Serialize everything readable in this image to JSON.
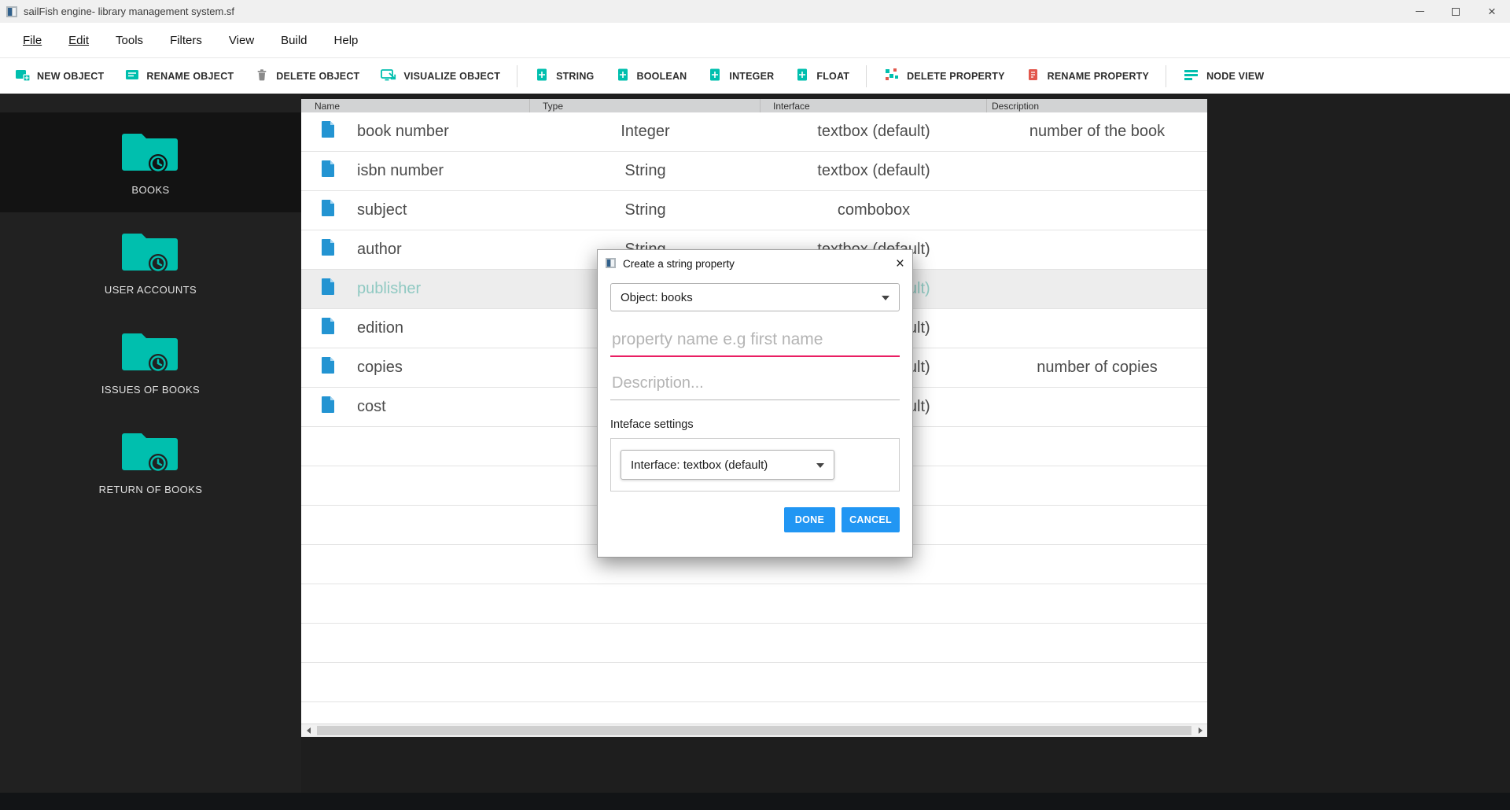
{
  "window": {
    "title": "sailFish engine- library management system.sf"
  },
  "menubar": {
    "items": [
      {
        "label": "File"
      },
      {
        "label": "Edit"
      },
      {
        "label": "Tools"
      },
      {
        "label": "Filters"
      },
      {
        "label": "View"
      },
      {
        "label": "Build"
      },
      {
        "label": "Help"
      }
    ]
  },
  "toolbar": {
    "groups": [
      {
        "buttons": [
          {
            "label": "NEW OBJECT",
            "icon": "new-object-icon"
          },
          {
            "label": "RENAME OBJECT",
            "icon": "rename-object-icon"
          },
          {
            "label": "DELETE OBJECT",
            "icon": "delete-object-icon"
          },
          {
            "label": "VISUALIZE OBJECT",
            "icon": "visualize-object-icon"
          }
        ]
      },
      {
        "buttons": [
          {
            "label": "STRING",
            "icon": "string-add-icon"
          },
          {
            "label": "BOOLEAN",
            "icon": "boolean-add-icon"
          },
          {
            "label": "INTEGER",
            "icon": "integer-add-icon"
          },
          {
            "label": "FLOAT",
            "icon": "float-add-icon"
          }
        ]
      },
      {
        "buttons": [
          {
            "label": "DELETE PROPERTY",
            "icon": "delete-property-icon"
          },
          {
            "label": "RENAME PROPERTY",
            "icon": "rename-property-icon"
          }
        ]
      },
      {
        "buttons": [
          {
            "label": "NODE VIEW",
            "icon": "node-view-icon"
          }
        ]
      }
    ]
  },
  "sidebar": {
    "items": [
      {
        "label": "BOOKS",
        "icon": "folder-history-icon",
        "selected": true
      },
      {
        "label": "USER ACCOUNTS",
        "icon": "folder-history-icon",
        "selected": false
      },
      {
        "label": "ISSUES OF BOOKS",
        "icon": "folder-history-icon",
        "selected": false
      },
      {
        "label": "RETURN OF BOOKS",
        "icon": "folder-history-icon",
        "selected": false
      }
    ]
  },
  "table": {
    "columns": [
      "Name",
      "Type",
      "Interface",
      "Description"
    ],
    "rows": [
      {
        "name": "book number",
        "type": "Integer",
        "interface": "textbox (default)",
        "description": "number of the book",
        "selected": false
      },
      {
        "name": "isbn number",
        "type": "String",
        "interface": "textbox (default)",
        "description": "",
        "selected": false
      },
      {
        "name": "subject",
        "type": "String",
        "interface": "combobox",
        "description": "",
        "selected": false
      },
      {
        "name": "author",
        "type": "String",
        "interface": "textbox (default)",
        "description": "",
        "selected": false
      },
      {
        "name": "publisher",
        "type": "",
        "interface": "textbox (default)",
        "description": "",
        "selected": true
      },
      {
        "name": "edition",
        "type": "",
        "interface": "textbox (default)",
        "description": "",
        "selected": false
      },
      {
        "name": "copies",
        "type": "",
        "interface": "textbox (default)",
        "description": "number of copies",
        "selected": false
      },
      {
        "name": "cost",
        "type": "",
        "interface": "textbox (default)",
        "description": "",
        "selected": false
      }
    ]
  },
  "dialog": {
    "title": "Create a string property",
    "object_select": {
      "value": "Object: books"
    },
    "property_input": {
      "value": "",
      "placeholder": "property name e.g first name"
    },
    "description_input": {
      "value": "",
      "placeholder": "Description..."
    },
    "interface_section_label": "Inteface settings",
    "interface_select": {
      "value": "Interface: textbox (default)"
    },
    "buttons": {
      "done": "DONE",
      "cancel": "CANCEL"
    }
  },
  "colors": {
    "accent_teal": "#00bfae",
    "selected_row_text": "#8fc9c2",
    "primary_button": "#2196f3",
    "focus_underline": "#e91e63",
    "file_icon_blue": "#2394d2"
  }
}
